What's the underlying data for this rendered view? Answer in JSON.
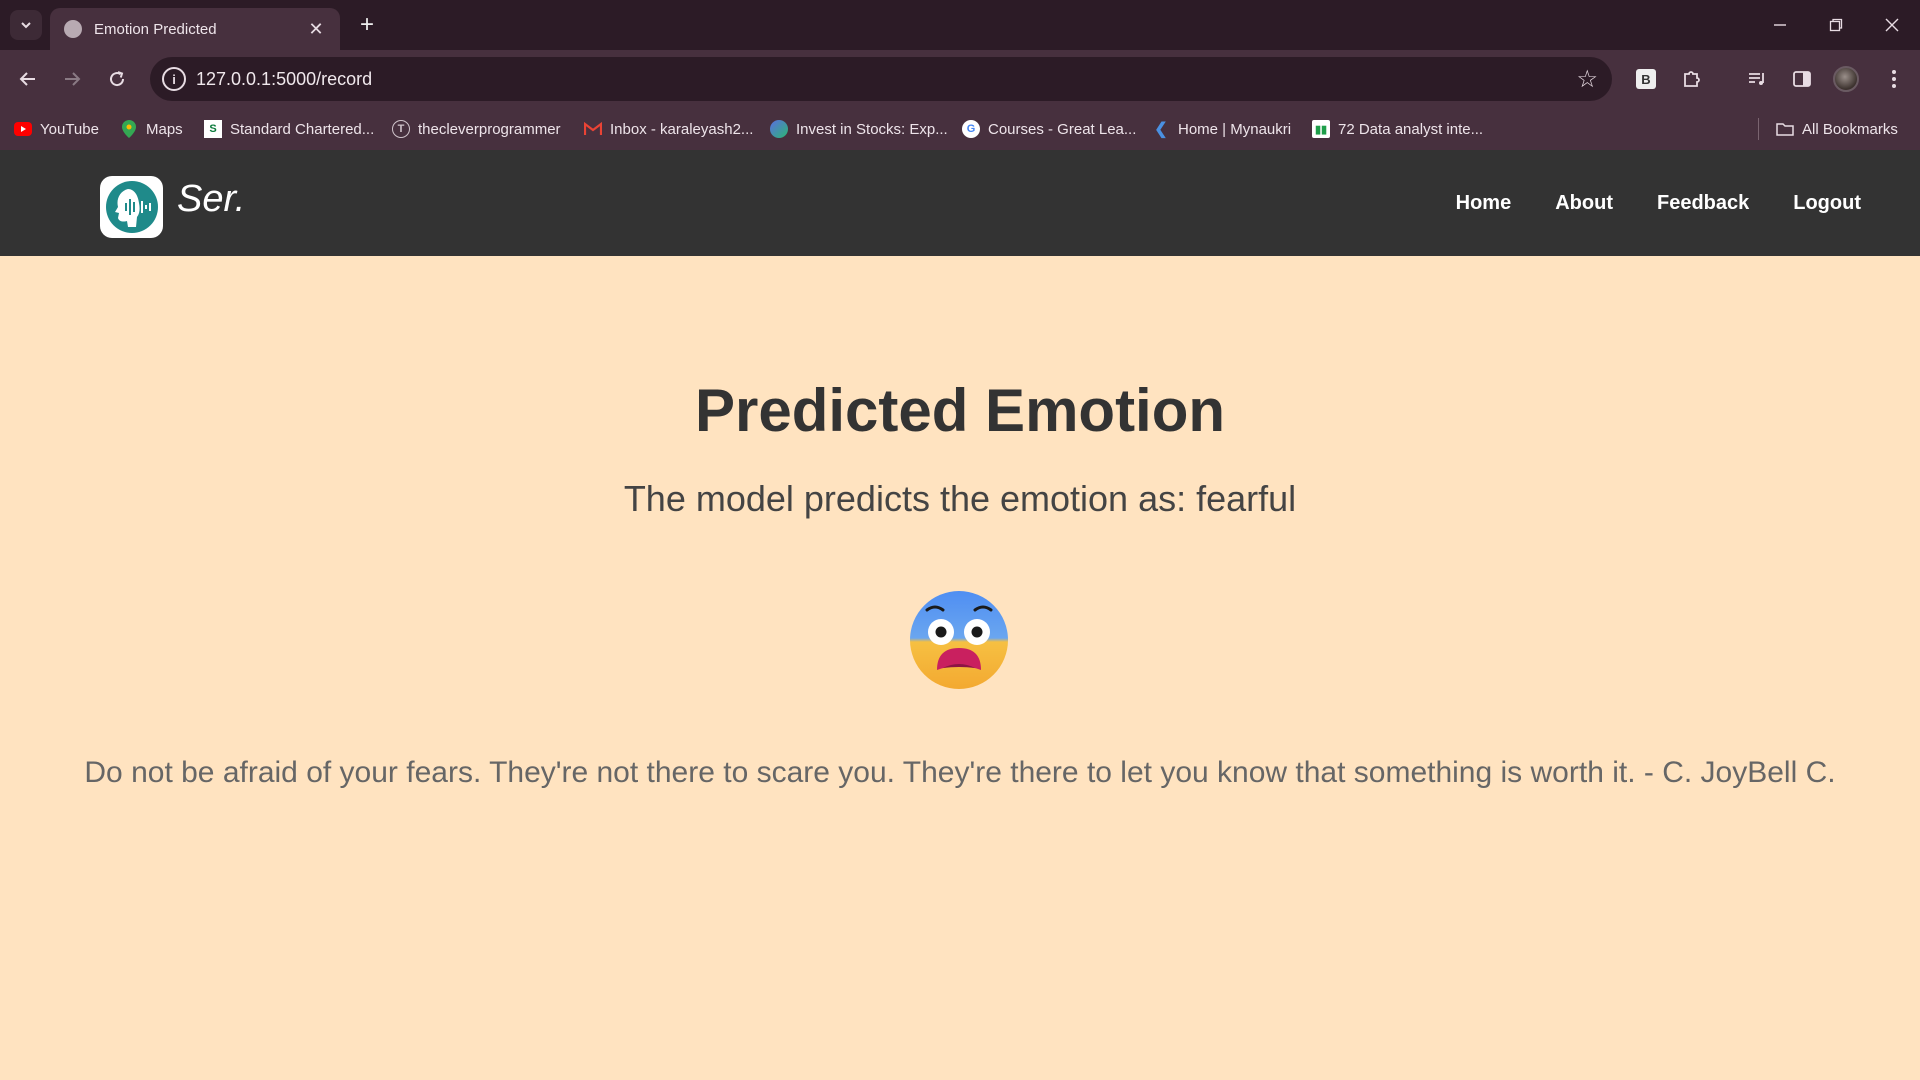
{
  "browser": {
    "tab_title": "Emotion Predicted",
    "url": "127.0.0.1:5000/record",
    "bookmarks": [
      {
        "label": "YouTube",
        "icon": "youtube-icon",
        "color": "#ff0000"
      },
      {
        "label": "Maps",
        "icon": "maps-icon",
        "color": "#34a853"
      },
      {
        "label": "Standard Chartered...",
        "icon": "standard-chartered-icon",
        "color": "#0a7a3b"
      },
      {
        "label": "thecleverprogrammer",
        "icon": "clever-programmer-icon",
        "color": "#9e9e9e"
      },
      {
        "label": "Inbox - karaleyash2...",
        "icon": "gmail-icon",
        "color": "#ea4335"
      },
      {
        "label": "Invest in Stocks: Exp...",
        "icon": "stocks-icon",
        "color": "#2bb673"
      },
      {
        "label": "Courses - Great Lea...",
        "icon": "google-icon",
        "color": "#4285f4"
      },
      {
        "label": "Home | Mynaukri",
        "icon": "naukri-icon",
        "color": "#4a90e2"
      },
      {
        "label": "72 Data analyst inte...",
        "icon": "data-analyst-icon",
        "color": "#1e9e4a"
      }
    ],
    "all_bookmarks": "All Bookmarks",
    "extension_b": "B"
  },
  "site": {
    "brand": "Ser.",
    "nav": {
      "home": "Home",
      "about": "About",
      "feedback": "Feedback",
      "logout": "Logout"
    }
  },
  "main": {
    "heading": "Predicted Emotion",
    "prediction_text": "The model predicts the emotion as: fearful",
    "emoji": "fearful-face-icon",
    "quote": "Do not be afraid of your fears. They're not there to scare you. They're there to let you know that something is worth it. - C. JoyBell C."
  },
  "colors": {
    "page_background": "#ffe3c0",
    "nav_background": "#333333",
    "logo_teal": "#1f8a8a"
  }
}
